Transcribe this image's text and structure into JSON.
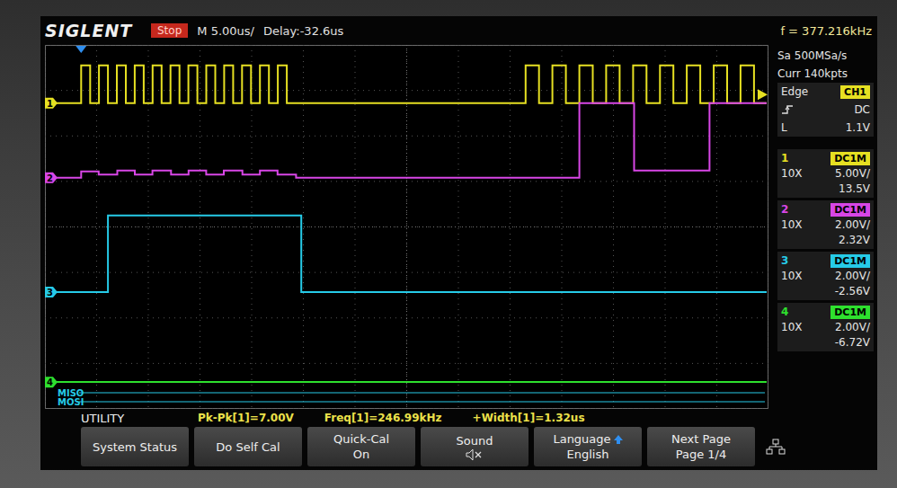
{
  "brand": "SIGLENT",
  "run_state": {
    "label": "Stop",
    "running": false
  },
  "timebase": "M 5.00us/",
  "delay": "Delay:-32.6us",
  "frequency": "f = 377.216kHz",
  "acquisition": {
    "sample_rate": "Sa 500MSa/s",
    "memory": "Curr 140kpts"
  },
  "trigger": {
    "type": "Edge",
    "source": "CH1",
    "slope": "rising",
    "coupling": "DC",
    "level_label": "L",
    "level": "1.1V"
  },
  "channels": [
    {
      "number": "1",
      "coupling": "DC1M",
      "probe": "10X",
      "scale": "5.00V/",
      "offset": "13.5V",
      "color": "#e6e022"
    },
    {
      "number": "2",
      "coupling": "DC1M",
      "probe": "10X",
      "scale": "2.00V/",
      "offset": "2.32V",
      "color": "#d846e6"
    },
    {
      "number": "3",
      "coupling": "DC1M",
      "probe": "10X",
      "scale": "2.00V/",
      "offset": "-2.56V",
      "color": "#26cbe8"
    },
    {
      "number": "4",
      "coupling": "DC1M",
      "probe": "10X",
      "scale": "2.00V/",
      "offset": "-6.72V",
      "color": "#2ee02e"
    }
  ],
  "chart": {
    "x_unit": "us",
    "x_range": [
      0,
      70
    ],
    "y_unit": "div",
    "y_range": [
      -4,
      4
    ],
    "grid": {
      "x_divisions": 14,
      "y_divisions": 8
    },
    "trigger_level": 2.91,
    "trigger_time": 3.5,
    "series": [
      {
        "channel": "1",
        "times": [
          0,
          3.5,
          4.37,
          5.23,
          6.1,
          6.96,
          7.83,
          8.69,
          9.56,
          10.42,
          11.29,
          12.15,
          13.02,
          13.88,
          14.75,
          15.61,
          16.48,
          17.34,
          18.21,
          19.07,
          19.94,
          20.8,
          21.67,
          22.53,
          23.4,
          46.5,
          47.8,
          49.1,
          50.4,
          51.7,
          53,
          54.3,
          55.6,
          56.9,
          58.2,
          59.5,
          60.8,
          62.1,
          63.4,
          64.7,
          66,
          67.3,
          68.6
        ],
        "values": [
          2.72,
          3.55,
          2.72,
          3.55,
          2.72,
          3.55,
          2.72,
          3.55,
          2.72,
          3.55,
          2.72,
          3.55,
          2.72,
          3.55,
          2.72,
          3.55,
          2.72,
          3.55,
          2.72,
          3.55,
          2.72,
          3.55,
          2.72,
          3.55,
          2.72,
          3.55,
          2.72,
          3.55,
          2.72,
          3.55,
          2.72,
          3.55,
          2.72,
          3.55,
          2.72,
          3.55,
          2.72,
          3.55,
          2.72,
          3.55,
          2.72,
          3.55,
          2.72
        ]
      },
      {
        "channel": "2",
        "times": [
          0,
          3.5,
          5.2,
          7,
          8.7,
          10.4,
          12.2,
          13.9,
          15.6,
          17.3,
          19.1,
          20.8,
          22.5,
          24.3,
          51.7,
          57,
          64.3
        ],
        "values": [
          1.08,
          1.22,
          1.15,
          1.24,
          1.15,
          1.24,
          1.15,
          1.24,
          1.15,
          1.24,
          1.15,
          1.24,
          1.15,
          1.08,
          2.72,
          1.24,
          2.72
        ]
      },
      {
        "channel": "3",
        "times": [
          0,
          6.1,
          24.8
        ],
        "values": [
          -1.43,
          0.25,
          -1.43
        ]
      },
      {
        "channel": "4",
        "times": [
          0
        ],
        "values": [
          -3.41
        ]
      }
    ],
    "buses": [
      {
        "label": "MISO"
      },
      {
        "label": "MOSI"
      }
    ]
  },
  "measurements": [
    {
      "text": "Pk-Pk[1]=7.00V"
    },
    {
      "text": "Freq[1]=246.99kHz"
    },
    {
      "text": "+Width[1]=1.32us"
    }
  ],
  "menu": {
    "title": "UTILITY",
    "softkeys": [
      {
        "label": "System Status",
        "value": "",
        "kind": "action"
      },
      {
        "label": "Do Self Cal",
        "value": "",
        "kind": "action"
      },
      {
        "label": "Quick-Cal",
        "value": "On",
        "kind": "option"
      },
      {
        "label": "Sound",
        "value": "",
        "kind": "sound",
        "muted": true
      },
      {
        "label": "Language",
        "value": "English",
        "kind": "knob"
      },
      {
        "label": "Next Page",
        "value": "Page 1/4",
        "kind": "option"
      },
      {
        "label": "",
        "value": "",
        "kind": "network"
      }
    ]
  }
}
